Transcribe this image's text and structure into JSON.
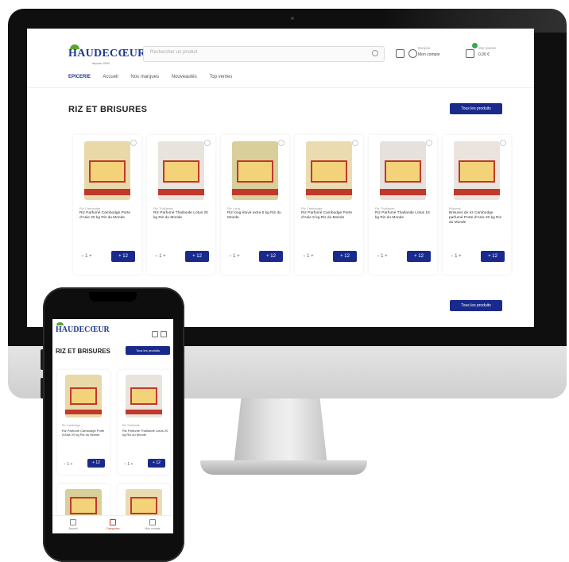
{
  "desktop": {
    "brand": {
      "name": "HAUDECŒUR",
      "tagline": "depuis 1900"
    },
    "search": {
      "placeholder": "Rechercher un produit"
    },
    "account": {
      "label": "Bonjour",
      "value": "Mon compte"
    },
    "cart": {
      "label": "Mon panier",
      "value": "0,00 €"
    },
    "nav": [
      "EPICERIE",
      "Accueil",
      "Nos marques",
      "Nouveautés",
      "Top ventes"
    ],
    "section_title": "RIZ ET BRISURES",
    "see_all": "Tous les produits",
    "products": [
      {
        "category": "Riz Cambodge",
        "name": "Riz Parfumé Cambodge Porte d'Asie 20 kg Riz du Monde",
        "qty": "1",
        "add": "+ 12",
        "color": "#e9d9a8"
      },
      {
        "category": "Riz Thaïlande",
        "name": "Riz Parfumé Thaïlande Lotus 20 kg Riz du Monde",
        "qty": "1",
        "add": "+ 12",
        "color": "#e8e3dd"
      },
      {
        "category": "Riz Long",
        "name": "Riz long étuvé extra 5 kg Riz du Monde",
        "qty": "1",
        "add": "+ 12",
        "color": "#d8cf9a"
      },
      {
        "category": "Riz Cambodge",
        "name": "Riz Parfumé Cambodge Porte d'Asie 5 kg Riz du Monde",
        "qty": "1",
        "add": "+ 12",
        "color": "#eadbb0"
      },
      {
        "category": "Riz Thaïlande",
        "name": "Riz Parfumé Thaïlande Lotus 18 kg Riz du Monde",
        "qty": "1",
        "add": "+ 12",
        "color": "#e6e1dc"
      },
      {
        "category": "Brisures",
        "name": "Brisures de riz Cambodge parfumé Porte d'Asie 20 kg Riz du Monde",
        "qty": "1",
        "add": "+ 12",
        "color": "#ebe3de"
      }
    ]
  },
  "mobile": {
    "brand": "HAUDECŒUR",
    "section_title": "RIZ ET BRISURES",
    "see_all": "Tous les produits",
    "products": [
      {
        "category": "Riz Cambodge",
        "name": "Riz Parfumé Cambodge Porte d'Asie 20 kg Riz du Monde",
        "qty": "1",
        "add": "+ 12",
        "color": "#e9d9a8"
      },
      {
        "category": "Riz Thaïlande",
        "name": "Riz Parfumé Thaïlande Lotus 20 kg Riz du Monde",
        "qty": "1",
        "add": "+ 12",
        "color": "#e8e3dd"
      }
    ],
    "bottom_nav": [
      "Accueil",
      "Catégories",
      "Mon compte"
    ]
  },
  "colors": {
    "brand_blue": "#1a2a8c",
    "brand_green": "#5aa532",
    "accent_red": "#c0392b"
  }
}
